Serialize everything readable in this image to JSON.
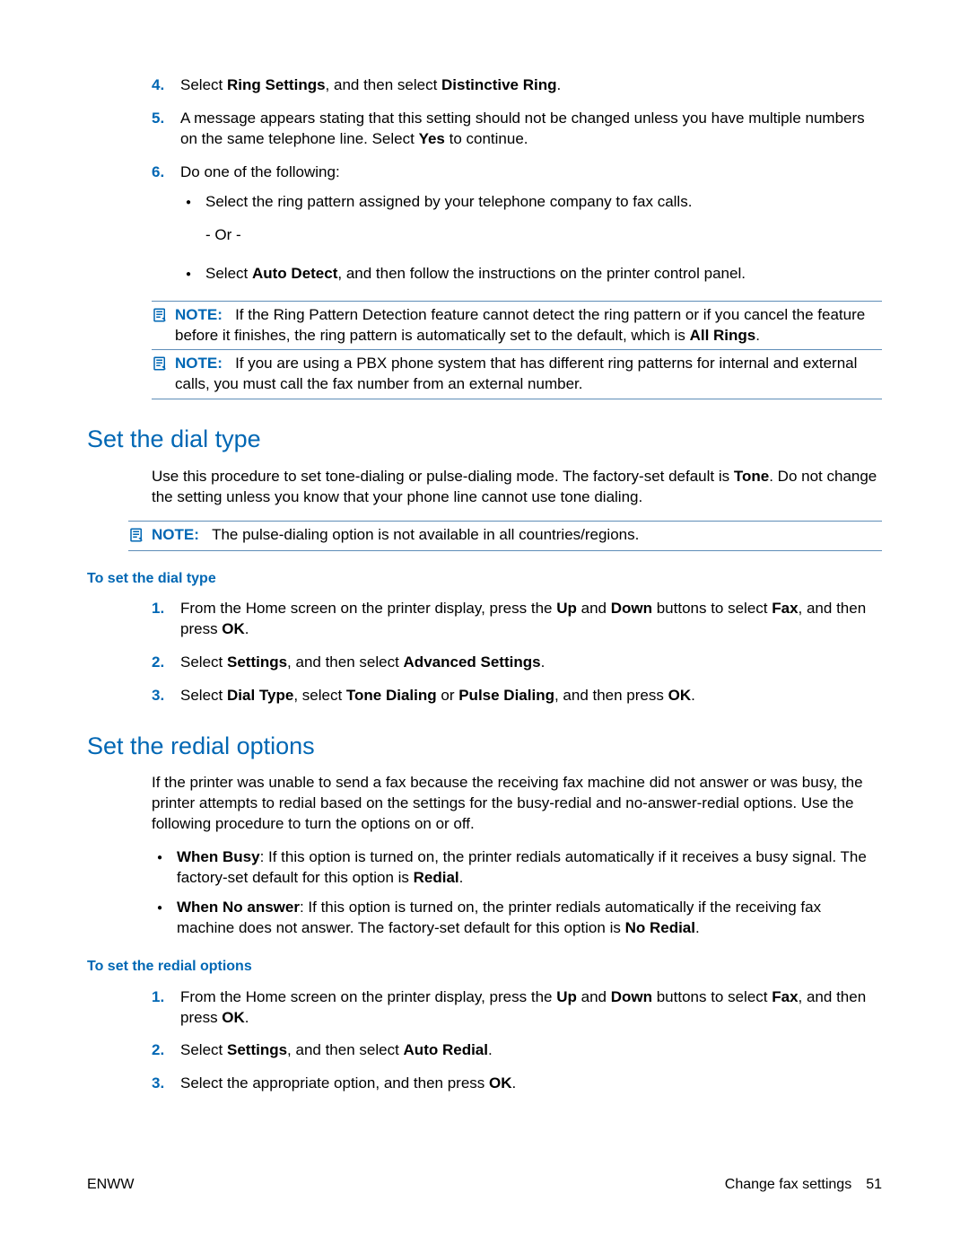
{
  "steps_top": {
    "s4": {
      "num": "4.",
      "pre": "Select ",
      "b1": "Ring Settings",
      "mid": ", and then select ",
      "b2": "Distinctive Ring",
      "post": "."
    },
    "s5": {
      "num": "5.",
      "line1": "A message appears stating that this setting should not be changed unless you have multiple numbers on the same telephone line. Select ",
      "b1": "Yes",
      "post": " to continue."
    },
    "s6": {
      "num": "6.",
      "intro": "Do one of the following:",
      "bullet1": "Select the ring pattern assigned by your telephone company to fax calls.",
      "or": "- Or -",
      "bullet2_pre": "Select ",
      "bullet2_b": "Auto Detect",
      "bullet2_post": ", and then follow the instructions on the printer control panel."
    }
  },
  "notes_top": {
    "n1": {
      "label": "NOTE:",
      "text_pre": "If the Ring Pattern Detection feature cannot detect the ring pattern or if you cancel the feature before it finishes, the ring pattern is automatically set to the default, which is ",
      "b1": "All Rings",
      "post": "."
    },
    "n2": {
      "label": "NOTE:",
      "text": "If you are using a PBX phone system that has different ring patterns for internal and external calls, you must call the fax number from an external number."
    }
  },
  "dial": {
    "heading": "Set the dial type",
    "para_pre": "Use this procedure to set tone-dialing or pulse-dialing mode. The factory-set default is ",
    "para_b": "Tone",
    "para_post": ". Do not change the setting unless you know that your phone line cannot use tone dialing.",
    "note": {
      "label": "NOTE:",
      "text": "The pulse-dialing option is not available in all countries/regions."
    },
    "proc_head": "To set the dial type",
    "s1": {
      "num": "1.",
      "pre": "From the Home screen on the printer display, press the ",
      "b1": "Up",
      "mid1": " and ",
      "b2": "Down",
      "mid2": " buttons to select ",
      "b3": "Fax",
      "mid3": ", and then press ",
      "b4": "OK",
      "post": "."
    },
    "s2": {
      "num": "2.",
      "pre": "Select ",
      "b1": "Settings",
      "mid": ", and then select ",
      "b2": "Advanced Settings",
      "post": "."
    },
    "s3": {
      "num": "3.",
      "pre": "Select ",
      "b1": "Dial Type",
      "mid1": ", select ",
      "b2": "Tone Dialing",
      "mid2": " or ",
      "b3": "Pulse Dialing",
      "mid3": ", and then press ",
      "b4": "OK",
      "post": "."
    }
  },
  "redial": {
    "heading": "Set the redial options",
    "para": "If the printer was unable to send a fax because the receiving fax machine did not answer or was busy, the printer attempts to redial based on the settings for the busy-redial and no-answer-redial options. Use the following procedure to turn the options on or off.",
    "b1": {
      "label": "When Busy",
      "text_pre": ": If this option is turned on, the printer redials automatically if it receives a busy signal. The factory-set default for this option is ",
      "b": "Redial",
      "post": "."
    },
    "b2": {
      "label": "When No answer",
      "text_pre": ": If this option is turned on, the printer redials automatically if the receiving fax machine does not answer. The factory-set default for this option is ",
      "b": "No Redial",
      "post": "."
    },
    "proc_head": "To set the redial options",
    "s1": {
      "num": "1.",
      "pre": "From the Home screen on the printer display, press the ",
      "b1": "Up",
      "mid1": " and ",
      "b2": "Down",
      "mid2": " buttons to select ",
      "b3": "Fax",
      "mid3": ", and then press ",
      "b4": "OK",
      "post": "."
    },
    "s2": {
      "num": "2.",
      "pre": "Select ",
      "b1": "Settings",
      "mid": ", and then select ",
      "b2": "Auto Redial",
      "post": "."
    },
    "s3": {
      "num": "3.",
      "pre": "Select the appropriate option, and then press ",
      "b1": "OK",
      "post": "."
    }
  },
  "footer": {
    "left": "ENWW",
    "right_label": "Change fax settings",
    "page": "51"
  }
}
